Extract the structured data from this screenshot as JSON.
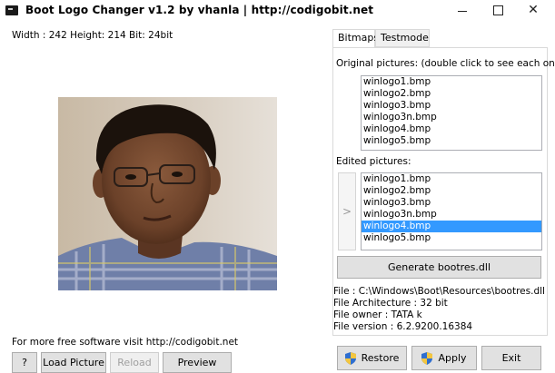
{
  "window": {
    "title": "Boot Logo Changer v1.2 by vhanla | http://codigobit.net",
    "minimize": "–",
    "maximize": "",
    "close": "✕"
  },
  "image_info": "Width : 242 Height: 214 Bit: 24bit",
  "footer": {
    "visit": "For more free software visit  http://codigobit.net",
    "help_label": "?",
    "load_label": "Load Picture",
    "reload_label": "Reload",
    "preview_label": "Preview"
  },
  "tabs": [
    {
      "label": "Bitmaps"
    },
    {
      "label": "Testmode"
    }
  ],
  "original": {
    "label": "Original pictures: (double click to see each one)",
    "items": [
      "winlogo1.bmp",
      "winlogo2.bmp",
      "winlogo3.bmp",
      "winlogo3n.bmp",
      "winlogo4.bmp",
      "winlogo5.bmp"
    ]
  },
  "edited": {
    "label": "Edited pictures:",
    "arrow": ">",
    "items": [
      "winlogo1.bmp",
      "winlogo2.bmp",
      "winlogo3.bmp",
      "winlogo3n.bmp",
      "winlogo4.bmp",
      "winlogo5.bmp"
    ],
    "selected_index": 4
  },
  "generate_label": "Generate bootres.dll",
  "file_info": {
    "file": "File : C:\\Windows\\Boot\\Resources\\bootres.dll",
    "arch": "File Architecture : 32 bit",
    "owner": "File owner : TATA k",
    "version": "File version : 6.2.9200.16384"
  },
  "actions": {
    "restore_label": "Restore",
    "apply_label": "Apply",
    "exit_label": "Exit"
  }
}
